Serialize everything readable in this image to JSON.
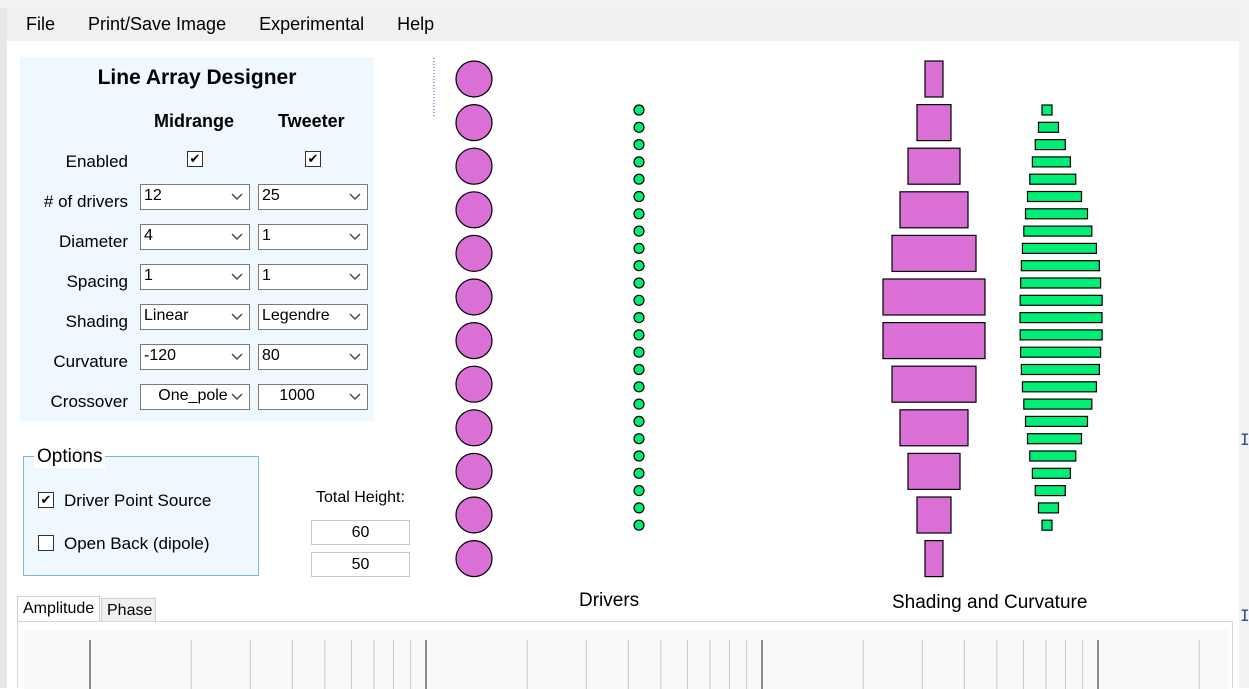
{
  "menu": [
    "File",
    "Print/Save Image",
    "Experimental",
    "Help"
  ],
  "designer": {
    "title": "Line Array Designer",
    "columns": [
      "Midrange",
      "Tweeter"
    ],
    "enabled_label": "Enabled",
    "enabled": {
      "midrange": true,
      "tweeter": true
    },
    "rows": [
      {
        "label": "# of drivers",
        "midrange": "12",
        "tweeter": "25"
      },
      {
        "label": "Diameter",
        "midrange": "4",
        "tweeter": "1"
      },
      {
        "label": "Spacing",
        "midrange": "1",
        "tweeter": "1"
      },
      {
        "label": "Shading",
        "midrange": "Linear",
        "tweeter": "Legendre"
      },
      {
        "label": "Curvature",
        "midrange": "-120",
        "tweeter": "80"
      },
      {
        "label": "Crossover",
        "midrange": "One_pole",
        "tweeter": "1000"
      }
    ]
  },
  "options": {
    "title": "Options",
    "items": [
      {
        "label": "Driver Point Source",
        "checked": true
      },
      {
        "label": "Open Back (dipole)",
        "checked": false
      }
    ]
  },
  "total_height": {
    "label": "Total Height:",
    "values": [
      "60",
      "50"
    ]
  },
  "captions": {
    "drivers": "Drivers",
    "shading": "Shading and Curvature"
  },
  "tabs": [
    "Amplitude",
    "Phase"
  ],
  "colors": {
    "midrange": "#da70d6",
    "tweeter": "#00ee76",
    "panel": "#eff8ff"
  },
  "icons": {
    "dropdown": "chevron-down-icon",
    "check": "checkmark-icon"
  },
  "shading_bars": {
    "midrange_widths": [
      18,
      34,
      52,
      68,
      84,
      102,
      102,
      84,
      68,
      52,
      34,
      18
    ],
    "tweeter_widths": [
      10,
      20,
      30,
      38,
      46,
      54,
      62,
      68,
      74,
      78,
      80,
      82,
      82,
      82,
      80,
      78,
      74,
      68,
      62,
      54,
      46,
      38,
      30,
      20,
      10
    ]
  }
}
